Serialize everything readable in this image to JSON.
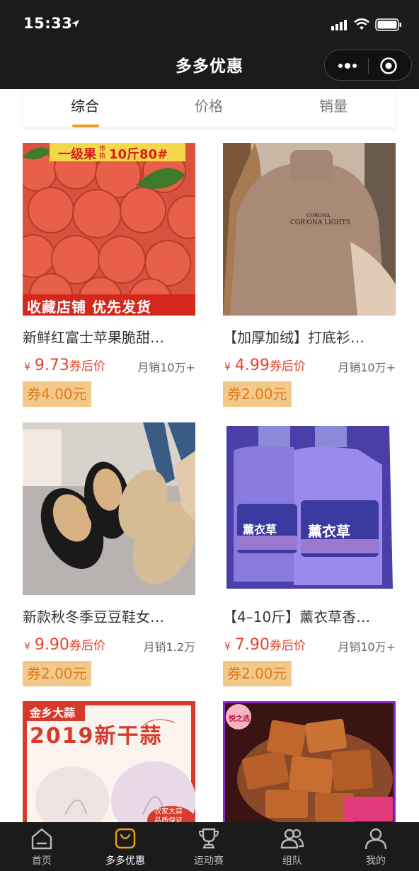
{
  "status_bar": {
    "time": "15:33"
  },
  "nav": {
    "title": "多多优惠"
  },
  "sort_tabs": [
    {
      "label": "综合",
      "active": true
    },
    {
      "label": "价格",
      "active": false
    },
    {
      "label": "销量",
      "active": false
    }
  ],
  "products": [
    {
      "name": "新鲜红富士苹果脆甜…",
      "price": "9.73",
      "price_suffix": "券后价",
      "sales": "月销10万+",
      "coupon": "券4.00元",
      "banner_top": "一级果",
      "banner_top_small": "带箱",
      "banner_top_right": "10斤80#",
      "banner_bottom": "收藏店铺 优先发货"
    },
    {
      "name": "【加厚加绒】打底衫…",
      "price": "4.99",
      "price_suffix": "券后价",
      "sales": "月销10万+",
      "coupon": "券2.00元",
      "shirt_text_1": "CORONA",
      "shirt_text_2": "COR'ONA LIGHTS"
    },
    {
      "name": "新款秋冬季豆豆鞋女…",
      "price": "9.90",
      "price_suffix": "券后价",
      "sales": "月销1.2万",
      "coupon": "券2.00元"
    },
    {
      "name": "【4–10斤】薰衣草香…",
      "price": "7.90",
      "price_suffix": "券后价",
      "sales": "月销10万+",
      "coupon": "券2.00元",
      "bottle_label": "薰衣草"
    },
    {
      "name": "",
      "banner_top": "金乡大蒜",
      "banner_title": "2019新干蒜",
      "banner_badge_1": "农家大蒜",
      "banner_badge_2": "品质保证"
    },
    {
      "name": "",
      "badge": "悦之选"
    }
  ],
  "tabbar": [
    {
      "label": "首页",
      "icon": "home-icon",
      "active": false
    },
    {
      "label": "多多优惠",
      "icon": "bag-icon",
      "active": true
    },
    {
      "label": "运动赛",
      "icon": "trophy-icon",
      "active": false
    },
    {
      "label": "组队",
      "icon": "team-icon",
      "active": false
    },
    {
      "label": "我的",
      "icon": "user-icon",
      "active": false
    }
  ],
  "colors": {
    "accent": "#e8a020",
    "price": "#e8412c",
    "coupon_bg": "#f3c98a",
    "coupon_text": "#e07a1a",
    "bar_bg": "#1b1b1b"
  }
}
